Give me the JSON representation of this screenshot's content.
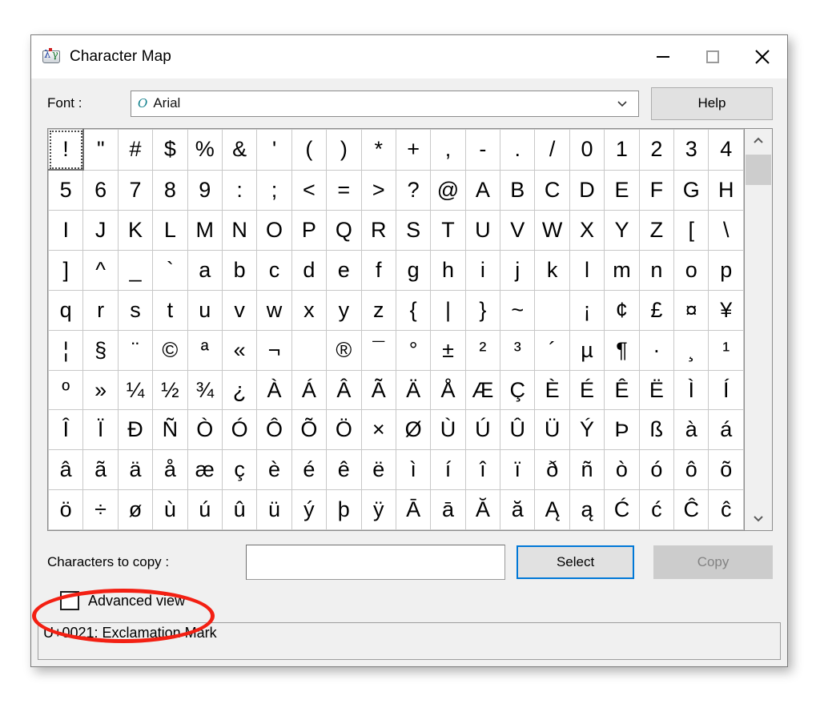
{
  "window": {
    "title": "Character Map",
    "icon": "character-map-icon",
    "controls": {
      "minimize": "minimize-icon",
      "maximize": "maximize-icon",
      "close": "close-icon"
    }
  },
  "font_row": {
    "label": "Font :",
    "ot_icon": "O",
    "selected_font": "Arial",
    "dropdown_icon": "chevron-down-icon",
    "help_label": "Help"
  },
  "grid": {
    "columns": 20,
    "selected_index": 0,
    "rows": [
      [
        "!",
        "\"",
        "#",
        "$",
        "%",
        "&",
        "'",
        "(",
        ")",
        "*",
        "+",
        ",",
        "-",
        ".",
        "/",
        "0",
        "1",
        "2",
        "3",
        "4"
      ],
      [
        "5",
        "6",
        "7",
        "8",
        "9",
        ":",
        ";",
        "<",
        "=",
        ">",
        "?",
        "@",
        "A",
        "B",
        "C",
        "D",
        "E",
        "F",
        "G",
        "H"
      ],
      [
        "I",
        "J",
        "K",
        "L",
        "M",
        "N",
        "O",
        "P",
        "Q",
        "R",
        "S",
        "T",
        "U",
        "V",
        "W",
        "X",
        "Y",
        "Z",
        "[",
        "\\"
      ],
      [
        "]",
        "^",
        "_",
        "`",
        "a",
        "b",
        "c",
        "d",
        "e",
        "f",
        "g",
        "h",
        "i",
        "j",
        "k",
        "l",
        "m",
        "n",
        "o",
        "p"
      ],
      [
        "q",
        "r",
        "s",
        "t",
        "u",
        "v",
        "w",
        "x",
        "y",
        "z",
        "{",
        "|",
        "}",
        "~",
        " ",
        "¡",
        "¢",
        "£",
        "¤",
        "¥"
      ],
      [
        "¦",
        "§",
        "¨",
        "©",
        "ª",
        "«",
        "¬",
        "­",
        "®",
        "¯",
        "°",
        "±",
        "²",
        "³",
        "´",
        "µ",
        "¶",
        "·",
        "¸",
        "¹"
      ],
      [
        "º",
        "»",
        "¼",
        "½",
        "¾",
        "¿",
        "À",
        "Á",
        "Â",
        "Ã",
        "Ä",
        "Å",
        "Æ",
        "Ç",
        "È",
        "É",
        "Ê",
        "Ë",
        "Ì",
        "Í"
      ],
      [
        "Î",
        "Ï",
        "Ð",
        "Ñ",
        "Ò",
        "Ó",
        "Ô",
        "Õ",
        "Ö",
        "×",
        "Ø",
        "Ù",
        "Ú",
        "Û",
        "Ü",
        "Ý",
        "Þ",
        "ß",
        "à",
        "á"
      ],
      [
        "â",
        "ã",
        "ä",
        "å",
        "æ",
        "ç",
        "è",
        "é",
        "ê",
        "ë",
        "ì",
        "í",
        "î",
        "ï",
        "ð",
        "ñ",
        "ò",
        "ó",
        "ô",
        "õ"
      ],
      [
        "ö",
        "÷",
        "ø",
        "ù",
        "ú",
        "û",
        "ü",
        "ý",
        "þ",
        "ÿ",
        "Ā",
        "ā",
        "Ă",
        "ă",
        "Ą",
        "ą",
        "Ć",
        "ć",
        "Ĉ",
        "ĉ"
      ]
    ],
    "scrollbar": {
      "up_icon": "chevron-up-icon",
      "down_icon": "chevron-down-icon",
      "thumb": "scrollbar-thumb"
    }
  },
  "bottom": {
    "copy_label": "Characters to copy :",
    "copy_input_value": "",
    "copy_input_placeholder": "",
    "select_label": "Select",
    "copy_button_label": "Copy",
    "copy_button_disabled": true,
    "advanced_view_label": "Advanced view",
    "advanced_view_checked": false
  },
  "status": {
    "text": "U+0021: Exclamation Mark"
  },
  "annotation": {
    "shape": "ellipse",
    "color": "#f32013",
    "target": "advanced-view-checkbox"
  }
}
